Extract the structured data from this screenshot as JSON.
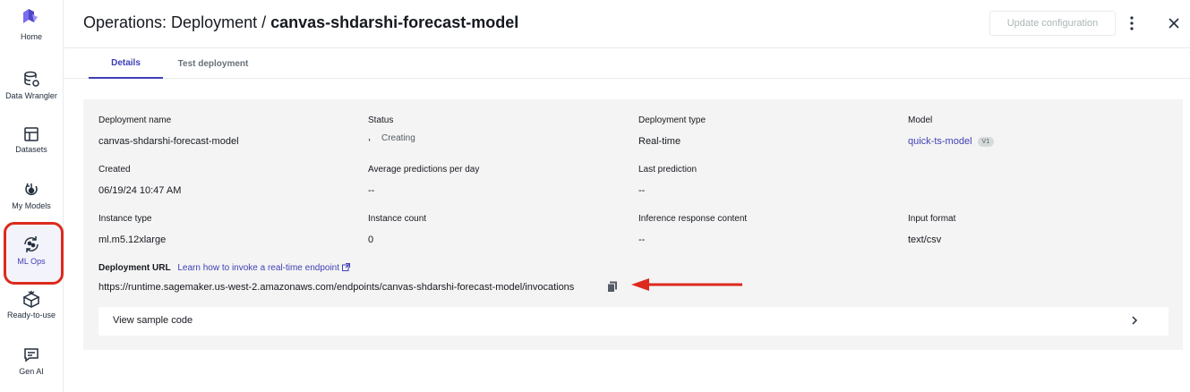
{
  "sidebar": {
    "items": [
      {
        "label": "Home",
        "icon": "home-logo"
      },
      {
        "label": "Data Wrangler",
        "icon": "data-wrangler-icon"
      },
      {
        "label": "Datasets",
        "icon": "datasets-icon"
      },
      {
        "label": "My Models",
        "icon": "my-models-icon"
      },
      {
        "label": "ML Ops",
        "icon": "ml-ops-icon",
        "active": true
      },
      {
        "label": "Ready-to-use",
        "icon": "ready-to-use-icon"
      },
      {
        "label": "Gen AI",
        "icon": "gen-ai-icon"
      }
    ]
  },
  "header": {
    "title_prefix": "Operations: Deployment / ",
    "title_name": "canvas-shdarshi-forecast-model",
    "update_button": "Update configuration",
    "more_icon": "vertical-ellipsis-icon",
    "close_icon": "close-icon"
  },
  "tabs": [
    {
      "label": "Details",
      "active": true
    },
    {
      "label": "Test deployment",
      "active": false
    }
  ],
  "details": {
    "deployment_name": {
      "label": "Deployment name",
      "value": "canvas-shdarshi-forecast-model"
    },
    "status": {
      "label": "Status",
      "value": "Creating"
    },
    "deployment_type": {
      "label": "Deployment type",
      "value": "Real-time"
    },
    "model": {
      "label": "Model",
      "value": "quick-ts-model",
      "badge": "V1"
    },
    "created": {
      "label": "Created",
      "value": "06/19/24 10:47 AM"
    },
    "avg_predictions": {
      "label": "Average predictions per day",
      "value": "--"
    },
    "last_prediction": {
      "label": "Last prediction",
      "value": "--"
    },
    "instance_type": {
      "label": "Instance type",
      "value": "ml.m5.12xlarge"
    },
    "instance_count": {
      "label": "Instance count",
      "value": "0"
    },
    "inference_response": {
      "label": "Inference response content",
      "value": "--"
    },
    "input_format": {
      "label": "Input format",
      "value": "text/csv"
    },
    "url": {
      "label": "Deployment URL",
      "learn_link": "Learn how to invoke a real-time endpoint",
      "value": "https://runtime.sagemaker.us-west-2.amazonaws.com/endpoints/canvas-shdarshi-forecast-model/invocations"
    },
    "sample_code": "View sample code"
  },
  "colors": {
    "accent": "#3f3fb7",
    "highlight": "#dc2a1c",
    "card_bg": "#f4f4f4"
  }
}
